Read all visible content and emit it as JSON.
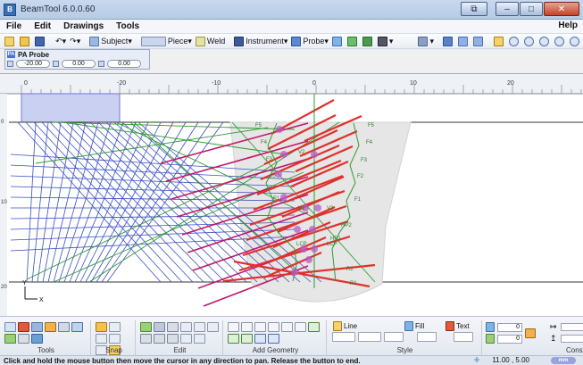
{
  "window": {
    "title": "BeamTool 6.0.0.60"
  },
  "menu": {
    "items": [
      "File",
      "Edit",
      "Drawings",
      "Tools"
    ],
    "help": "Help"
  },
  "toolbar": {
    "subject": "Subject",
    "piece": "Piece",
    "weld": "Weld",
    "instrument": "Instrument",
    "probe": "Probe",
    "dropdown": "▾"
  },
  "probe_panel": {
    "title": "PA Probe",
    "values": [
      "-20.00",
      "0.00",
      "0.00"
    ]
  },
  "ruler": {
    "h_labels": [
      "0",
      "-20",
      "-10",
      "0",
      "10",
      "20"
    ],
    "v_labels": [
      "0",
      "10",
      "20"
    ]
  },
  "axis": {
    "y": "Y",
    "x": "X"
  },
  "canvas_labels": {
    "left": [
      "F5",
      "F4",
      "F3",
      "F2",
      "F1",
      "V1",
      "LCP",
      "V2"
    ],
    "right": [
      "F5",
      "F4",
      "F3",
      "F2",
      "F1",
      "V3",
      "HP2",
      "HP1",
      "LCP",
      "R2",
      "R1"
    ]
  },
  "ribbon": {
    "groups": [
      "Tools",
      "Snap",
      "Edit",
      "Add Geometry",
      "Style",
      "Construct"
    ],
    "line": "Line",
    "fill": "Fill",
    "text": "Text",
    "num1": "0",
    "num2": "0"
  },
  "status": {
    "message": "Click and hold the mouse button then move the cursor in any direction to pan. Release the button to end.",
    "coords": "11.00 , 5.00",
    "unit": "mm"
  },
  "colors": {
    "blue_rays": "#3a4fc2",
    "green_rays": "#2e9a2e",
    "red_rays": "#e0302c",
    "magenta_rays": "#c0186a",
    "weld_fill": "#e6e6e6"
  }
}
